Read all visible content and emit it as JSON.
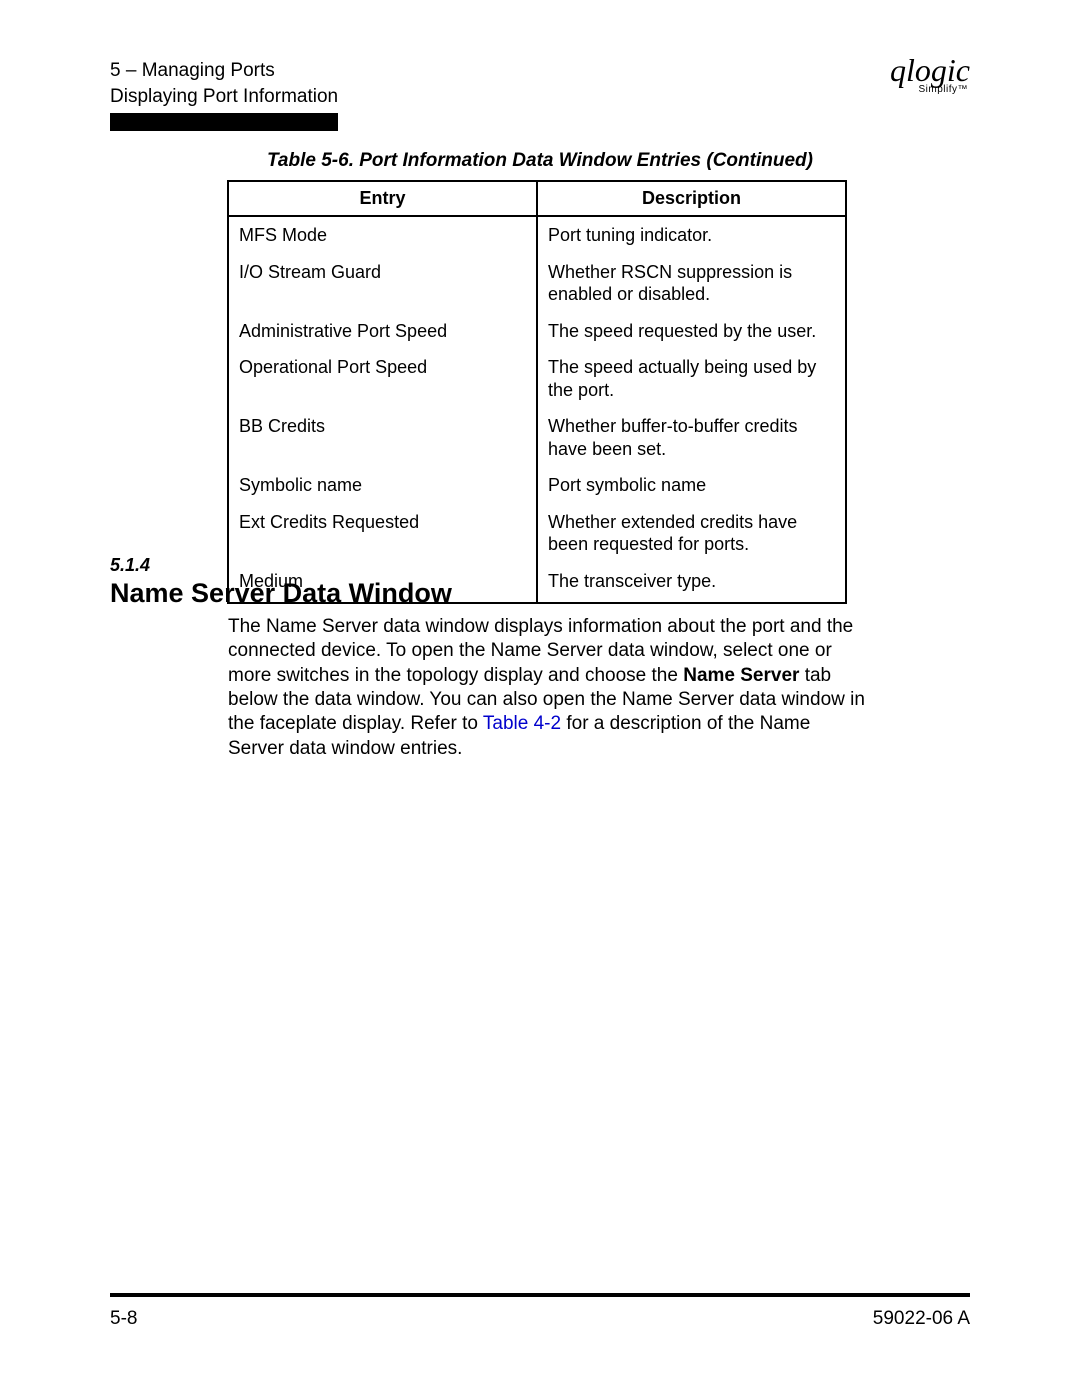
{
  "header": {
    "line1": "5 – Managing Ports",
    "line2": "Displaying Port Information"
  },
  "logo": {
    "script": "qlogic",
    "sub": "Simplify™"
  },
  "table": {
    "caption": "Table 5-6. Port Information Data Window Entries (Continued)",
    "headers": {
      "entry": "Entry",
      "description": "Description"
    },
    "rows": [
      {
        "entry": "MFS Mode",
        "description": "Port tuning indicator."
      },
      {
        "entry": "I/O Stream Guard",
        "description": "Whether RSCN suppression is enabled or disabled."
      },
      {
        "entry": "Administrative Port Speed",
        "description": "The speed requested by the user."
      },
      {
        "entry": "Operational Port Speed",
        "description": "The speed actually being used by the port."
      },
      {
        "entry": "BB Credits",
        "description": "Whether buffer-to-buffer credits have been set."
      },
      {
        "entry": "Symbolic name",
        "description": "Port symbolic name"
      },
      {
        "entry": "Ext Credits Requested",
        "description": "Whether extended credits have been requested for ports."
      },
      {
        "entry": "Medium",
        "description": "The transceiver type."
      }
    ]
  },
  "section": {
    "number": "5.1.4",
    "title": "Name Server Data Window",
    "body_pre": "The Name Server data window displays information about the port and the connected device. To open the Name Server data window, select one or more switches in the topology display and choose the ",
    "body_bold": "Name Server",
    "body_mid": " tab below the data window. You can also open the Name Server data window in the faceplate display. Refer to ",
    "body_link": "Table 4-2",
    "body_post": " for a description of the Name Server data window entries."
  },
  "footer": {
    "left": "5-8",
    "right": "59022-06  A"
  }
}
